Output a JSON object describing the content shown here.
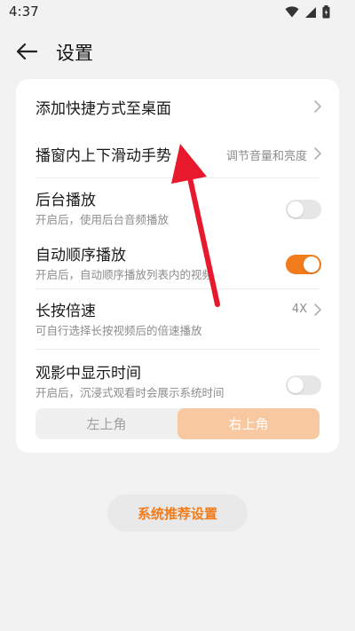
{
  "status_bar": {
    "time": "4:37",
    "icons": [
      "wifi-icon",
      "signal-icon",
      "battery-icon"
    ]
  },
  "header": {
    "title": "设置",
    "back_icon": "arrow-left-icon"
  },
  "settings": {
    "desktop_shortcut": {
      "title": "添加快捷方式至桌面"
    },
    "swipe_gesture": {
      "title": "播窗内上下滑动手势",
      "value": "调节音量和亮度"
    },
    "background_play": {
      "title": "后台播放",
      "subtitle": "开启后，使用后台音频播放",
      "enabled": false
    },
    "auto_play": {
      "title": "自动顺序播放",
      "subtitle": "开启后，自动顺序播放列表内的视频",
      "enabled": true
    },
    "long_press_speed": {
      "title": "长按倍速",
      "subtitle": "可自行选择长按视频后的倍速播放",
      "value": "4X"
    },
    "show_time": {
      "title": "观影中显示时间",
      "subtitle": "开启后，沉浸式观看时会展示系统时间",
      "enabled": false,
      "position_options": [
        "左上角",
        "右上角"
      ],
      "position_selected": "右上角"
    }
  },
  "bottom_button": {
    "label": "系统推荐设置"
  },
  "colors": {
    "accent": "#f27b1b",
    "accent_light": "#f8c9a0",
    "annotation_arrow": "#e8192c",
    "background": "#f2f2f2",
    "card": "#ffffff"
  }
}
